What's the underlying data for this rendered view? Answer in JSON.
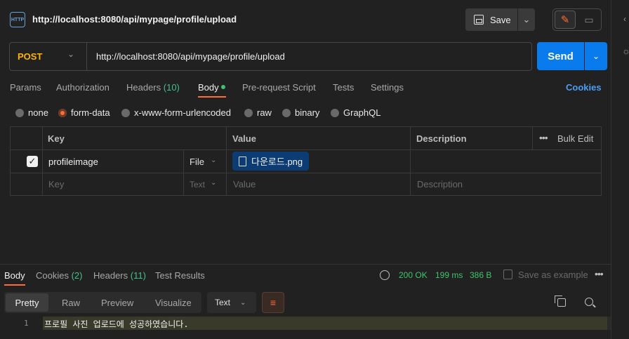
{
  "tab": {
    "title": "http://localhost:8080/api/mypage/profile/upload",
    "icon": "http-icon"
  },
  "toolbar": {
    "save_label": "Save"
  },
  "request": {
    "method": "POST",
    "url": "http://localhost:8080/api/mypage/profile/upload",
    "send_label": "Send",
    "tabs": [
      {
        "label": "Params"
      },
      {
        "label": "Authorization"
      },
      {
        "label": "Headers",
        "count": "(10)"
      },
      {
        "label": "Body"
      },
      {
        "label": "Pre-request Script"
      },
      {
        "label": "Tests"
      },
      {
        "label": "Settings"
      }
    ],
    "cookies_label": "Cookies"
  },
  "body_types": [
    "none",
    "form-data",
    "x-www-form-urlencoded",
    "raw",
    "binary",
    "GraphQL"
  ],
  "body_type_selected": "form-data",
  "table": {
    "headers": {
      "key": "Key",
      "value": "Value",
      "description": "Description",
      "bulk_edit": "Bulk Edit"
    },
    "rows": [
      {
        "checked": true,
        "key": "profileimage",
        "type": "File",
        "value": "다운로드.png",
        "description": ""
      }
    ],
    "placeholder": {
      "key": "Key",
      "type": "Text",
      "value": "Value",
      "description": "Description"
    }
  },
  "response": {
    "tabs": [
      {
        "label": "Body"
      },
      {
        "label": "Cookies",
        "count": "(2)"
      },
      {
        "label": "Headers",
        "count": "(11)"
      },
      {
        "label": "Test Results"
      }
    ],
    "status": "200 OK",
    "time": "199 ms",
    "size": "386 B",
    "save_example": "Save as example",
    "views": [
      "Pretty",
      "Raw",
      "Preview",
      "Visualize"
    ],
    "format": "Text",
    "lines": [
      {
        "num": "1",
        "text": "프로필 사진 업로드에 성공하였습니다."
      }
    ]
  },
  "colors": {
    "accent": "#ff6c37",
    "send": "#097bed",
    "method": "#ffb400",
    "success": "#3ec46d"
  }
}
